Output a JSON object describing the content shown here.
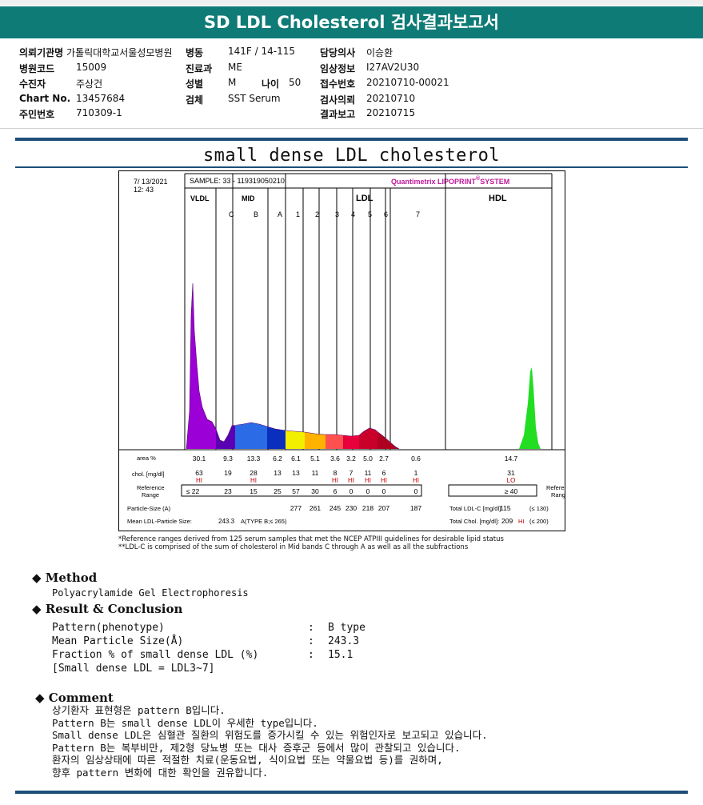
{
  "title": "SD LDL Cholesterol 검사결과보고서",
  "patient_info": {
    "institution_label": "의뢰기관명",
    "institution": "가톨릭대학교서울성모병원",
    "hospital_code_label": "병원코드",
    "hospital_code": "15009",
    "examinee_label": "수진자",
    "examinee": "주상건",
    "chart_label": "Chart No.",
    "chart_no": "13457684",
    "resident_label": "주민번호",
    "resident_no": "710309-1",
    "ward_label": "병동",
    "ward": "141F / 14-115",
    "dept_label": "진료과",
    "dept": "ME",
    "sex_label": "성별",
    "sex": "M",
    "age_label": "나이",
    "age": "50",
    "specimen_label": "검체",
    "specimen": "SST Serum",
    "doctor_label": "담당의사",
    "doctor": "이승환",
    "clinical_label": "임상정보",
    "clinical": "I27AV2U30",
    "receipt_label": "접수번호",
    "receipt": "20210710-00021",
    "request_label": "검사의뢰",
    "request": "20210710",
    "report_label": "결과보고",
    "report": "20210715"
  },
  "report_title": "small dense LDL cholesterol",
  "chart_data": {
    "type": "area",
    "date": "7/ 13/2021",
    "time": "12: 43",
    "sample": "SAMPLE:  33 - 119319050210",
    "system": "Quantimetrix LIPOPRINT",
    "system_reg": "®",
    "system_suffix": "SYSTEM",
    "groups": [
      "VLDL",
      "MID",
      "LDL",
      "HDL"
    ],
    "bands": [
      "C",
      "B",
      "A",
      "1",
      "2",
      "3",
      "4",
      "5",
      "6",
      "7"
    ],
    "row_labels": {
      "area": "area %",
      "chol": "chol. [mg/dl]",
      "ref": "Reference Range",
      "size": "Particle-Size (A)",
      "mean": "Mean LDL-Particle Size:",
      "ref_right": "Reference Range"
    },
    "area_pct": [
      "30.1",
      "9.3",
      "13.3",
      "6.2",
      "6.1",
      "5.1",
      "3.6",
      "3.2",
      "5.0",
      "2.7",
      "0.6",
      "14.7"
    ],
    "chol": [
      "63",
      "19",
      "28",
      "13",
      "13",
      "11",
      "8",
      "7",
      "11",
      "6",
      "1",
      "31"
    ],
    "flags": [
      "HI",
      "",
      "HI",
      "",
      "",
      "",
      "HI",
      "HI",
      "HI",
      "HI",
      "HI",
      "LO"
    ],
    "ref_range": [
      "≤ 22",
      "23",
      "15",
      "25",
      "57",
      "30",
      "6",
      "0",
      "0",
      "0",
      "0",
      "≥ 40"
    ],
    "particle_size": [
      "277",
      "261",
      "245",
      "230",
      "218",
      "207",
      "187"
    ],
    "total_ldl_label": "Total LDL-C [mg/dl]:",
    "total_ldl": "115",
    "total_ldl_ref": "(≤ 130)",
    "total_chol_label": "Total Chol. [mg/dl]:",
    "total_chol": "209",
    "total_chol_flag": "HI",
    "total_chol_ref": "(≤ 200)",
    "mean_size": "243.3",
    "mean_type": "A(TYPE B;≤ 265)",
    "series_colors": [
      "#9b00d6",
      "#5a00b4",
      "#2b6be6",
      "#0a2fbe",
      "#f2ef00",
      "#ffb300",
      "#ff5050",
      "#e8003c",
      "#c8002a",
      "#b00020",
      "#ffffff",
      "#22dd22"
    ]
  },
  "footnotes": [
    "*Reference ranges derived from 125 serum samples that met the NCEP ATPIII guidelines for desirable lipid status",
    "**LDL-C is comprised of the sum of cholesterol in Mid bands C through A as well as all the subfractions"
  ],
  "method": {
    "title": "Method",
    "text": "Polyacrylamide Gel Electrophoresis"
  },
  "result": {
    "title": "Result & Conclusion",
    "items": [
      {
        "label": "Pattern(phenotype)",
        "value": "B type"
      },
      {
        "label": "Mean Particle Size(Å)",
        "value": "243.3"
      },
      {
        "label": "Fraction % of small dense LDL (%)",
        "value": "15.1"
      }
    ],
    "note": "[Small dense LDL = LDL3~7]"
  },
  "comment": {
    "title": "Comment",
    "lines": [
      "상기환자 표현형은 pattern B입니다.",
      "Pattern B는 small dense LDL이 우세한 type입니다.",
      "Small dense LDL은 심혈관 질환의 위험도를 증가시킬 수 있는 위험인자로 보고되고 있습니다.",
      "Pattern B는 복부비만, 제2형 당뇨병 또는 대사 증후군 등에서 많이 관찰되고 있습니다.",
      "환자의 임상상태에 따른 적절한 치료(운동요법, 식이요법 또는 약물요법 등)를 권하며,",
      "향후 pattern 변화에 대한 확인을 권유합니다."
    ]
  }
}
